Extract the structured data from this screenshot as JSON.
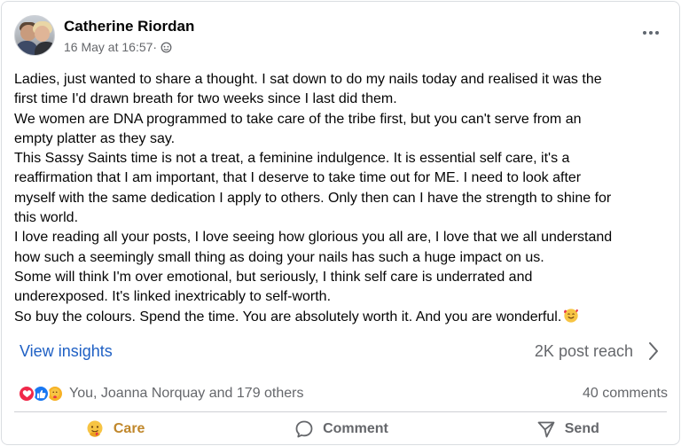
{
  "author": {
    "name": "Catherine Riordan",
    "timestamp": "16 May at 16:57",
    "separator": "·"
  },
  "post": {
    "lines": [
      "Ladies, just wanted to share a thought.  I sat down to do my nails today and realised it was the",
      "first time I'd drawn breath for two weeks since I last did them.",
      "We women are DNA programmed to take care of the tribe first, but you can't serve from an",
      "empty platter as they say.",
      "This Sassy Saints time is not a treat, a feminine indulgence. It is essential self care, it's a",
      "reaffirmation that I am important, that I deserve to take time out for ME. I need to look after",
      "myself with the same dedication I apply to others.  Only then can I have the strength to shine for",
      "this world.",
      "I love reading all your posts, I love seeing how glorious you all are,  I love that we all understand",
      "how such a seemingly small thing as doing your nails has such a huge impact on us.",
      "Some will think I'm over emotional, but seriously, I think self care is underrated and",
      "underexposed. It's linked inextricably to self-worth.",
      "So buy the colours. Spend the time. You are absolutely worth it. And you are wonderful."
    ]
  },
  "insights": {
    "link_label": "View insights",
    "reach": "2K post reach"
  },
  "engagement": {
    "reactors": "You, Joanna Norquay and 179 others",
    "comments": "40 comments"
  },
  "actions": {
    "care_label": "Care",
    "comment_label": "Comment",
    "send_label": "Send"
  },
  "colors": {
    "link": "#1f60c4",
    "secondary_text": "#65676b",
    "care": "#c0872b",
    "love": "#f02849",
    "like": "#1877f2"
  }
}
